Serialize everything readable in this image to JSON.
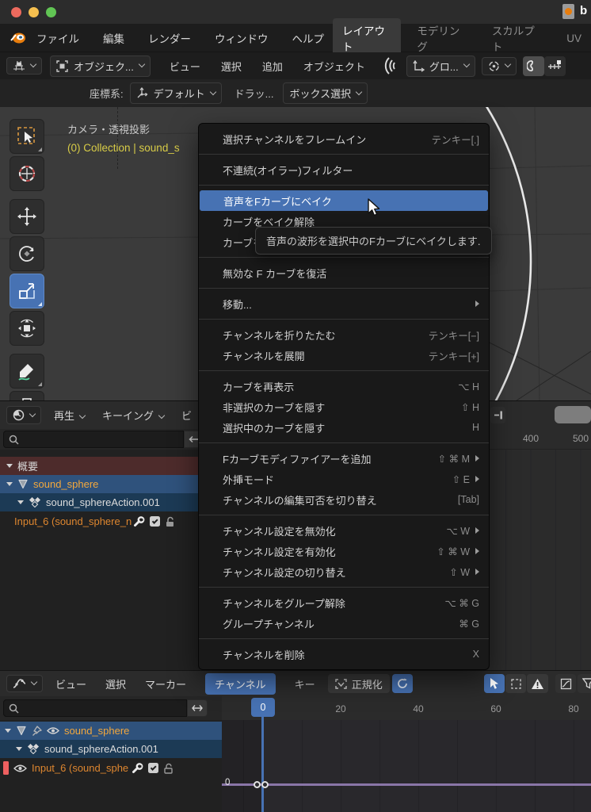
{
  "colors": {
    "accent": "#4772b3",
    "selected_row": "#2f527c",
    "action_row": "#1c3a55",
    "summary_row": "#4d2b2b",
    "object_text": "#f3a83d",
    "channel_text": "#de862f",
    "curve": "#8a76a8"
  },
  "titlebar": {
    "doc_name": "b"
  },
  "menubar": {
    "items": [
      {
        "label": "ファイル"
      },
      {
        "label": "編集"
      },
      {
        "label": "レンダー"
      },
      {
        "label": "ウィンドウ"
      },
      {
        "label": "ヘルプ"
      }
    ],
    "workspaces": [
      {
        "label": "レイアウト",
        "active": true
      },
      {
        "label": "モデリング"
      },
      {
        "label": "スカルプト"
      },
      {
        "label": "UV"
      }
    ]
  },
  "viewport_header": {
    "mode_label": "オブジェク...",
    "menus": [
      {
        "label": "ビュー"
      },
      {
        "label": "選択"
      },
      {
        "label": "追加"
      },
      {
        "label": "オブジェクト"
      }
    ],
    "orientation_label": "グロ..."
  },
  "tool_settings": {
    "coord_label": "座標系:",
    "coord_value": "デフォルト",
    "drag_label": "ドラッ...",
    "select_mode": "ボックス選択"
  },
  "viewport": {
    "view_label": "カメラ・透視投影",
    "collection_label": "(0) Collection | sound_s"
  },
  "context_menu": {
    "tooltip": "音声の波形を選択中のFカーブにベイクします.",
    "items": [
      {
        "label": "選択チャンネルをフレームイン",
        "shortcut": "テンキー[.]"
      },
      {
        "sep": true
      },
      {
        "label": "不連続(オイラー)フィルター"
      },
      {
        "sep": true
      },
      {
        "label": "音声をFカーブにベイク",
        "highlight": true
      },
      {
        "label": "カーブをベイク解除"
      },
      {
        "label": "カーブをベイク"
      },
      {
        "sep": true
      },
      {
        "label": "無効な F カーブを復活"
      },
      {
        "sep": true
      },
      {
        "label": "移動...",
        "submenu": true
      },
      {
        "sep": true
      },
      {
        "label": "チャンネルを折りたたむ",
        "shortcut": "テンキー[−]"
      },
      {
        "label": "チャンネルを展開",
        "shortcut": "テンキー[+]"
      },
      {
        "sep": true
      },
      {
        "label": "カーブを再表示",
        "shortcut": "⌥ H"
      },
      {
        "label": "非選択のカーブを隠す",
        "shortcut": "⇧ H"
      },
      {
        "label": "選択中のカーブを隠す",
        "shortcut": "H"
      },
      {
        "sep": true
      },
      {
        "label": "Fカーブモディファイアーを追加",
        "shortcut": "⇧ ⌘ M",
        "submenu": true
      },
      {
        "label": "外挿モード",
        "shortcut": "⇧ E",
        "submenu": true
      },
      {
        "label": "チャンネルの編集可否を切り替え",
        "shortcut": "[Tab]"
      },
      {
        "sep": true
      },
      {
        "label": "チャンネル設定を無効化",
        "shortcut": "⌥ W",
        "submenu": true
      },
      {
        "label": "チャンネル設定を有効化",
        "shortcut": "⇧ ⌘ W",
        "submenu": true
      },
      {
        "label": "チャンネル設定の切り替え",
        "shortcut": "⇧ W",
        "submenu": true
      },
      {
        "sep": true
      },
      {
        "label": "チャンネルをグループ解除",
        "shortcut": "⌥ ⌘ G"
      },
      {
        "label": "グループチャンネル",
        "shortcut": "⌘ G"
      },
      {
        "sep": true
      },
      {
        "label": "チャンネルを削除",
        "shortcut": "X"
      }
    ]
  },
  "dope_sheet": {
    "menus": [
      {
        "label": "再生",
        "chev": true
      },
      {
        "label": "キーイング",
        "chev": true
      },
      {
        "label": "ビ"
      }
    ],
    "search_value": "",
    "ruler": {
      "t1": "400",
      "t2": "500"
    },
    "rows": {
      "summary": "概要",
      "object": "sound_sphere",
      "action": "sound_sphereAction.001",
      "channel": "Input_6 (sound_sphere_n"
    }
  },
  "graph_editor": {
    "menus": [
      {
        "label": "ビュー"
      },
      {
        "label": "選択"
      },
      {
        "label": "マーカー"
      },
      {
        "label": "チャンネル",
        "active": true
      },
      {
        "label": "キー"
      }
    ],
    "normalize_label": "正規化",
    "search_value": "",
    "playhead": "0",
    "ruler": {
      "t1": "20",
      "t2": "40",
      "t3": "60",
      "t4": "80"
    },
    "rows": {
      "object": "sound_sphere",
      "action": "sound_sphereAction.001",
      "channel": "Input_6 (sound_sphe"
    },
    "value_label": "0"
  }
}
